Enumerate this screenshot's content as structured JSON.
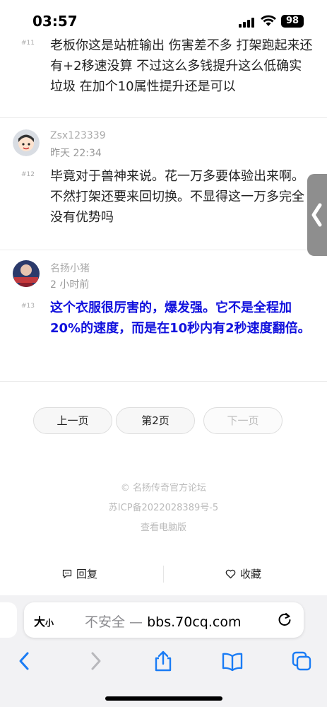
{
  "status": {
    "time": "03:57",
    "battery": "98"
  },
  "posts": [
    {
      "floor": "#11",
      "text": "老板你这是站桩输出  伤害差不多  打架跑起来还有+2移速没算  不过这么多钱提升这么低确实垃圾    在加个10属性提升还是可以"
    },
    {
      "floor": "#12",
      "username": "Zsx123339",
      "time": "昨天 22:34",
      "text": "毕竟对于兽神来说。花一万多要体验出来啊。不然打架还要来回切换。不显得这一万多完全没有优势吗"
    },
    {
      "floor": "#13",
      "username": "名扬小猪",
      "time": "2 小时前",
      "text": "这个衣服很厉害的，爆发强。它不是全程加20%的速度，而是在10秒内有2秒速度翻倍。"
    }
  ],
  "pager": {
    "prev": "上一页",
    "current": "第2页",
    "next": "下一页"
  },
  "footer": {
    "copyright": "© 名扬传奇官方论坛",
    "icp": "苏ICP备2022028389号-5",
    "desktop": "查看电脑版"
  },
  "actions": {
    "reply": "回复",
    "favorite": "收藏"
  },
  "browser": {
    "aa_big": "大",
    "aa_small": "小",
    "insecure": "不安全 —",
    "domain": "bbs.70cq.com"
  },
  "colors": {
    "post_highlight": "#1111dd",
    "toolbar_accent": "#1a7cf5"
  }
}
